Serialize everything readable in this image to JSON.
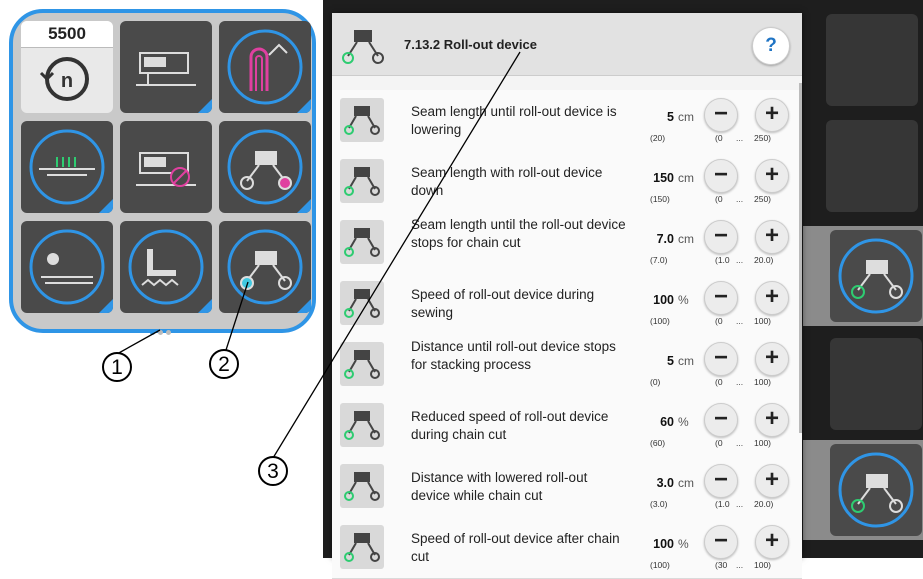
{
  "counter": {
    "value": "5500"
  },
  "popup": {
    "title": "7.13.2 Roll-out device",
    "help": "?",
    "minus": "−",
    "plus": "+",
    "range_sep": "...",
    "rows": [
      {
        "label": "Seam length until roll-out device is lowering",
        "value": "5",
        "unit": "cm",
        "default": "(20)",
        "min": "(0",
        "max": "250)"
      },
      {
        "label": "Seam length with roll-out device down",
        "value": "150",
        "unit": "cm",
        "default": "(150)",
        "min": "(0",
        "max": "250)"
      },
      {
        "label": "Seam length until the roll-out device stops for chain cut",
        "value": "7.0",
        "unit": "cm",
        "default": "(7.0)",
        "min": "(1.0",
        "max": "20.0)"
      },
      {
        "label": "Speed of roll-out device during sewing",
        "value": "100",
        "unit": "%",
        "default": "(100)",
        "min": "(0",
        "max": "100)"
      },
      {
        "label": "Distance until roll-out device stops for stacking process",
        "value": "5",
        "unit": "cm",
        "default": "(0)",
        "min": "(0",
        "max": "100)"
      },
      {
        "label": "Reduced speed of roll-out device during chain cut",
        "value": "60",
        "unit": "%",
        "default": "(60)",
        "min": "(0",
        "max": "100)"
      },
      {
        "label": "Distance with lowered roll-out device while chain cut",
        "value": "3.0",
        "unit": "cm",
        "default": "(3.0)",
        "min": "(1.0",
        "max": "20.0)"
      },
      {
        "label": "Speed of roll-out device after chain cut",
        "value": "100",
        "unit": "%",
        "default": "(100)",
        "min": "(30",
        "max": "100)"
      }
    ]
  },
  "callouts": {
    "one": "1",
    "two": "2",
    "three": "3"
  },
  "icons": [
    "counter-reset-icon",
    "sewing-machine-icon",
    "thread-tension-icon",
    "stitch-icon",
    "machine-stop-icon",
    "roll-out-device-icon",
    "stacker-icon",
    "chain-cut-icon",
    "roll-out-device-active-icon"
  ],
  "colors": {
    "accent": "#2f95e6",
    "active_green": "#2ecc71",
    "pink": "#e040a0"
  }
}
